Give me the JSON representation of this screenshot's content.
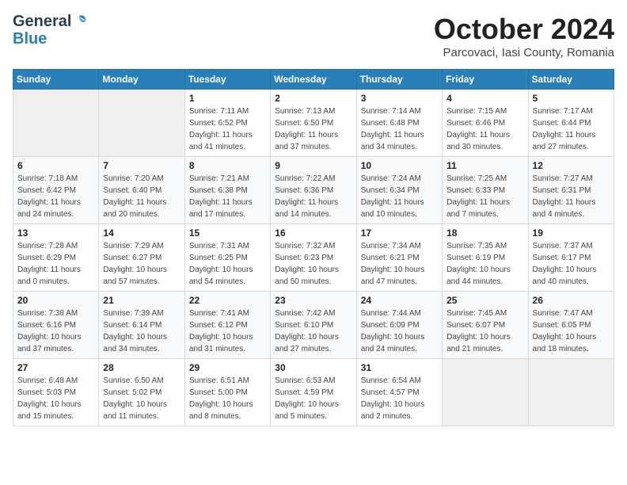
{
  "header": {
    "logo": {
      "general": "General",
      "blue": "Blue"
    },
    "title": "October 2024",
    "location": "Parcovaci, Iasi County, Romania"
  },
  "weekdays": [
    "Sunday",
    "Monday",
    "Tuesday",
    "Wednesday",
    "Thursday",
    "Friday",
    "Saturday"
  ],
  "weeks": [
    [
      {
        "day": "",
        "info": ""
      },
      {
        "day": "",
        "info": ""
      },
      {
        "day": "1",
        "info": "Sunrise: 7:11 AM\nSunset: 6:52 PM\nDaylight: 11 hours and 41 minutes."
      },
      {
        "day": "2",
        "info": "Sunrise: 7:13 AM\nSunset: 6:50 PM\nDaylight: 11 hours and 37 minutes."
      },
      {
        "day": "3",
        "info": "Sunrise: 7:14 AM\nSunset: 6:48 PM\nDaylight: 11 hours and 34 minutes."
      },
      {
        "day": "4",
        "info": "Sunrise: 7:15 AM\nSunset: 6:46 PM\nDaylight: 11 hours and 30 minutes."
      },
      {
        "day": "5",
        "info": "Sunrise: 7:17 AM\nSunset: 6:44 PM\nDaylight: 11 hours and 27 minutes."
      }
    ],
    [
      {
        "day": "6",
        "info": "Sunrise: 7:18 AM\nSunset: 6:42 PM\nDaylight: 11 hours and 24 minutes."
      },
      {
        "day": "7",
        "info": "Sunrise: 7:20 AM\nSunset: 6:40 PM\nDaylight: 11 hours and 20 minutes."
      },
      {
        "day": "8",
        "info": "Sunrise: 7:21 AM\nSunset: 6:38 PM\nDaylight: 11 hours and 17 minutes."
      },
      {
        "day": "9",
        "info": "Sunrise: 7:22 AM\nSunset: 6:36 PM\nDaylight: 11 hours and 14 minutes."
      },
      {
        "day": "10",
        "info": "Sunrise: 7:24 AM\nSunset: 6:34 PM\nDaylight: 11 hours and 10 minutes."
      },
      {
        "day": "11",
        "info": "Sunrise: 7:25 AM\nSunset: 6:33 PM\nDaylight: 11 hours and 7 minutes."
      },
      {
        "day": "12",
        "info": "Sunrise: 7:27 AM\nSunset: 6:31 PM\nDaylight: 11 hours and 4 minutes."
      }
    ],
    [
      {
        "day": "13",
        "info": "Sunrise: 7:28 AM\nSunset: 6:29 PM\nDaylight: 11 hours and 0 minutes."
      },
      {
        "day": "14",
        "info": "Sunrise: 7:29 AM\nSunset: 6:27 PM\nDaylight: 10 hours and 57 minutes."
      },
      {
        "day": "15",
        "info": "Sunrise: 7:31 AM\nSunset: 6:25 PM\nDaylight: 10 hours and 54 minutes."
      },
      {
        "day": "16",
        "info": "Sunrise: 7:32 AM\nSunset: 6:23 PM\nDaylight: 10 hours and 50 minutes."
      },
      {
        "day": "17",
        "info": "Sunrise: 7:34 AM\nSunset: 6:21 PM\nDaylight: 10 hours and 47 minutes."
      },
      {
        "day": "18",
        "info": "Sunrise: 7:35 AM\nSunset: 6:19 PM\nDaylight: 10 hours and 44 minutes."
      },
      {
        "day": "19",
        "info": "Sunrise: 7:37 AM\nSunset: 6:17 PM\nDaylight: 10 hours and 40 minutes."
      }
    ],
    [
      {
        "day": "20",
        "info": "Sunrise: 7:38 AM\nSunset: 6:16 PM\nDaylight: 10 hours and 37 minutes."
      },
      {
        "day": "21",
        "info": "Sunrise: 7:39 AM\nSunset: 6:14 PM\nDaylight: 10 hours and 34 minutes."
      },
      {
        "day": "22",
        "info": "Sunrise: 7:41 AM\nSunset: 6:12 PM\nDaylight: 10 hours and 31 minutes."
      },
      {
        "day": "23",
        "info": "Sunrise: 7:42 AM\nSunset: 6:10 PM\nDaylight: 10 hours and 27 minutes."
      },
      {
        "day": "24",
        "info": "Sunrise: 7:44 AM\nSunset: 6:09 PM\nDaylight: 10 hours and 24 minutes."
      },
      {
        "day": "25",
        "info": "Sunrise: 7:45 AM\nSunset: 6:07 PM\nDaylight: 10 hours and 21 minutes."
      },
      {
        "day": "26",
        "info": "Sunrise: 7:47 AM\nSunset: 6:05 PM\nDaylight: 10 hours and 18 minutes."
      }
    ],
    [
      {
        "day": "27",
        "info": "Sunrise: 6:48 AM\nSunset: 5:03 PM\nDaylight: 10 hours and 15 minutes."
      },
      {
        "day": "28",
        "info": "Sunrise: 6:50 AM\nSunset: 5:02 PM\nDaylight: 10 hours and 11 minutes."
      },
      {
        "day": "29",
        "info": "Sunrise: 6:51 AM\nSunset: 5:00 PM\nDaylight: 10 hours and 8 minutes."
      },
      {
        "day": "30",
        "info": "Sunrise: 6:53 AM\nSunset: 4:59 PM\nDaylight: 10 hours and 5 minutes."
      },
      {
        "day": "31",
        "info": "Sunrise: 6:54 AM\nSunset: 4:57 PM\nDaylight: 10 hours and 2 minutes."
      },
      {
        "day": "",
        "info": ""
      },
      {
        "day": "",
        "info": ""
      }
    ]
  ]
}
